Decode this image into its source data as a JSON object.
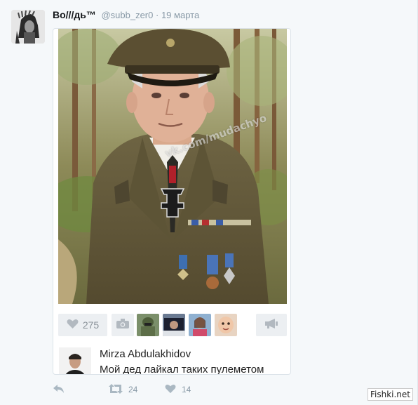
{
  "tweet": {
    "author_name": "Во///дь™",
    "handle": "@subb_zer0",
    "separator": "·",
    "date": "19 марта"
  },
  "card": {
    "watermark": "vk.com/mudachyo",
    "likes": {
      "count": "275",
      "icon": "heart-icon"
    },
    "camera_icon": "camera-icon",
    "share_icon": "megaphone-icon",
    "comment": {
      "author": "Mirza Abdulakhidov",
      "text": "Мой дед лайкал таких пулеметом"
    }
  },
  "actions": {
    "reply_icon": "reply-icon",
    "retweet_count": "24",
    "like_count": "14"
  },
  "site_watermark": "Fishki.net",
  "colors": {
    "background": "#f5f8fa",
    "muted": "#8899a6",
    "name": "#14171a"
  }
}
